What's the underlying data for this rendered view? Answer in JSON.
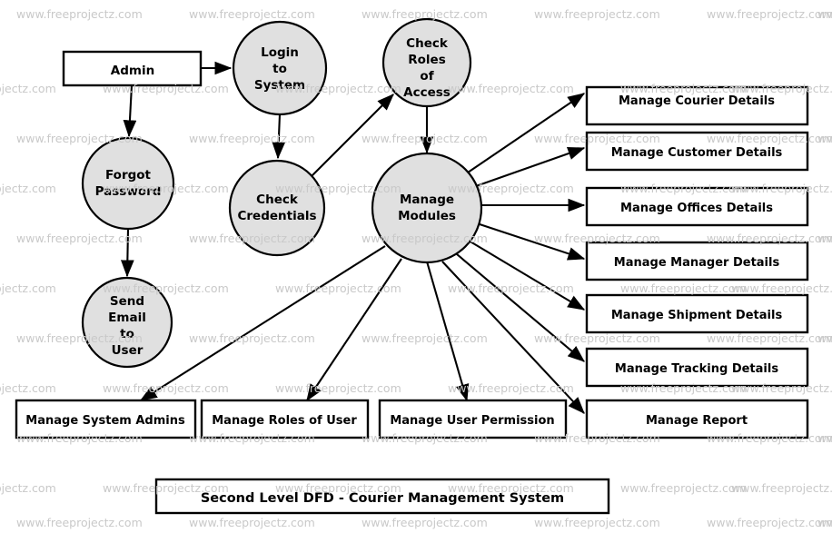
{
  "watermark": {
    "text": "www.freeprojectz.com",
    "color": "#c9c9c9"
  },
  "diagram": {
    "title_box": {
      "label": "Second Level DFD - Courier Management System"
    },
    "external_entity": {
      "label": "Admin"
    },
    "processes": [
      {
        "id": "login-to-system",
        "label": "Login\nto\nSystem"
      },
      {
        "id": "check-roles-of-access",
        "label": "Check\nRoles\nof\nAccess"
      },
      {
        "id": "forgot-password",
        "label": "Forgot\nPassword"
      },
      {
        "id": "check-credentials",
        "label": "Check\nCredentials"
      },
      {
        "id": "send-email-to-user",
        "label": "Send\nEmail\nto\nUser"
      },
      {
        "id": "manage-modules",
        "label": "Manage\nModules"
      }
    ],
    "right_boxes": [
      {
        "id": "manage-courier-details",
        "label": "Manage Courier Details"
      },
      {
        "id": "manage-customer-details",
        "label": "Manage Customer Details"
      },
      {
        "id": "manage-offices-details",
        "label": "Manage Offices Details"
      },
      {
        "id": "manage-manager-details",
        "label": "Manage Manager Details"
      },
      {
        "id": "manage-shipment-details",
        "label": "Manage Shipment Details"
      },
      {
        "id": "manage-tracking-details",
        "label": "Manage Tracking Details"
      },
      {
        "id": "manage-report",
        "label": "Manage Report"
      }
    ],
    "bottom_boxes": [
      {
        "id": "manage-system-admins",
        "label": "Manage System Admins"
      },
      {
        "id": "manage-roles-of-user",
        "label": "Manage Roles of User"
      },
      {
        "id": "manage-user-permission",
        "label": "Manage User Permission"
      }
    ],
    "colors": {
      "process_fill": "#e0e0e0",
      "box_fill": "#ffffff",
      "stroke": "#000000",
      "background": "#ffffff"
    }
  }
}
